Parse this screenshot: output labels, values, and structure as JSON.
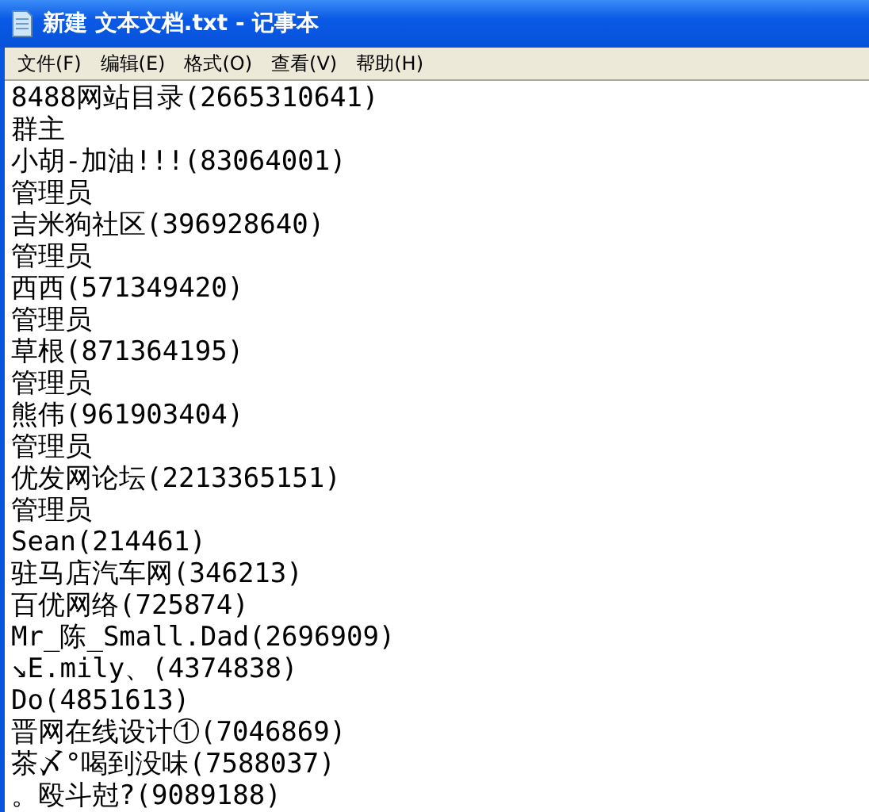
{
  "window": {
    "title": "新建 文本文档.txt - 记事本"
  },
  "menu": [
    {
      "label": "文件(F)"
    },
    {
      "label": "编辑(E)"
    },
    {
      "label": "格式(O)"
    },
    {
      "label": "查看(V)"
    },
    {
      "label": "帮助(H)"
    }
  ],
  "document": {
    "lines": [
      "8488网站目录(2665310641)",
      "群主",
      "小胡-加油!!!(83064001)",
      "管理员",
      "吉米狗社区(396928640)",
      "管理员",
      "西西(571349420)",
      "管理员",
      "草根(871364195)",
      "管理员",
      "熊伟(961903404)",
      "管理员",
      "优发网论坛(2213365151)",
      "管理员",
      "Sean(214461)",
      "驻马店汽车网(346213)",
      "百优网络(725874)",
      "Mr_陈_Small.Dad(2696909)",
      "↘E.mily、(4374838)",
      "Do(4851613)",
      "晋网在线设计①(7046869)",
      "茶〆°喝到没味(7588037)",
      "。殴斗尅?(9089188)"
    ]
  }
}
